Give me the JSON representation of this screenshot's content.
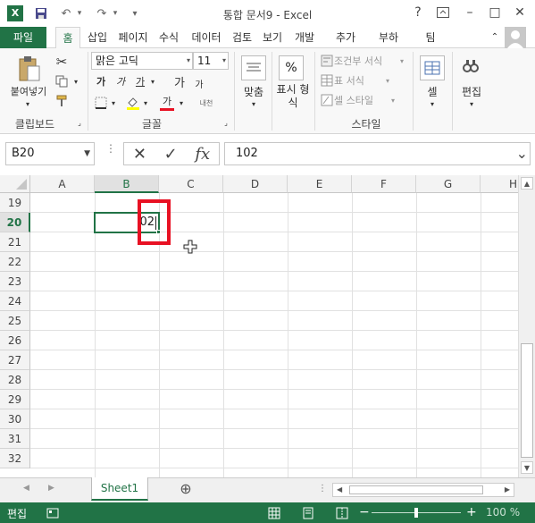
{
  "window": {
    "title": "통합 문서9 - Excel",
    "help": "?",
    "min": "–",
    "max": "□",
    "close": "✕"
  },
  "quick_access": {
    "undo": "↶",
    "redo": "↷",
    "customize": "▾"
  },
  "tabs": {
    "file": "파일",
    "items": [
      "홈",
      "삽입",
      "페이지",
      "수식",
      "데이터",
      "검토",
      "보기",
      "개발",
      "추가",
      "부하",
      "팀"
    ],
    "active": "홈",
    "collapse": "⌃"
  },
  "ribbon": {
    "clipboard": {
      "paste": "붙여넣기",
      "group": "클립보드"
    },
    "font": {
      "name": "맑은 고딕",
      "size": "11",
      "bold": "가",
      "italic": "가",
      "underline": "가",
      "grow": "가",
      "shrink": "가",
      "color_a": "가",
      "phonetic": "내천",
      "group": "글꼴"
    },
    "align": {
      "label": "맞춤"
    },
    "number": {
      "symbol": "%",
      "label": "표시 형식"
    },
    "styles": {
      "conditional": "조건부 서식",
      "table": "표 서식",
      "cell_style": "셀 스타일",
      "group": "스타일"
    },
    "cells": {
      "label": "셀"
    },
    "editing": {
      "label": "편집"
    }
  },
  "formula_bar": {
    "name_box": "B20",
    "cancel": "✕",
    "enter": "✓",
    "fx": "fx",
    "value": "102"
  },
  "grid": {
    "columns": [
      "A",
      "B",
      "C",
      "D",
      "E",
      "F",
      "G",
      "H"
    ],
    "rows": [
      "19",
      "20",
      "21",
      "22",
      "23",
      "24",
      "25",
      "26",
      "27",
      "28",
      "29",
      "30",
      "31",
      "32"
    ],
    "selected_column": "B",
    "selected_row": "20",
    "active_cell_visible_text": "02"
  },
  "sheets": {
    "tabs": [
      "Sheet1"
    ],
    "add": "⊕"
  },
  "status": {
    "mode": "편집",
    "zoom": "100 %"
  },
  "colors": {
    "accent": "#217346",
    "highlight": "#e81123"
  }
}
